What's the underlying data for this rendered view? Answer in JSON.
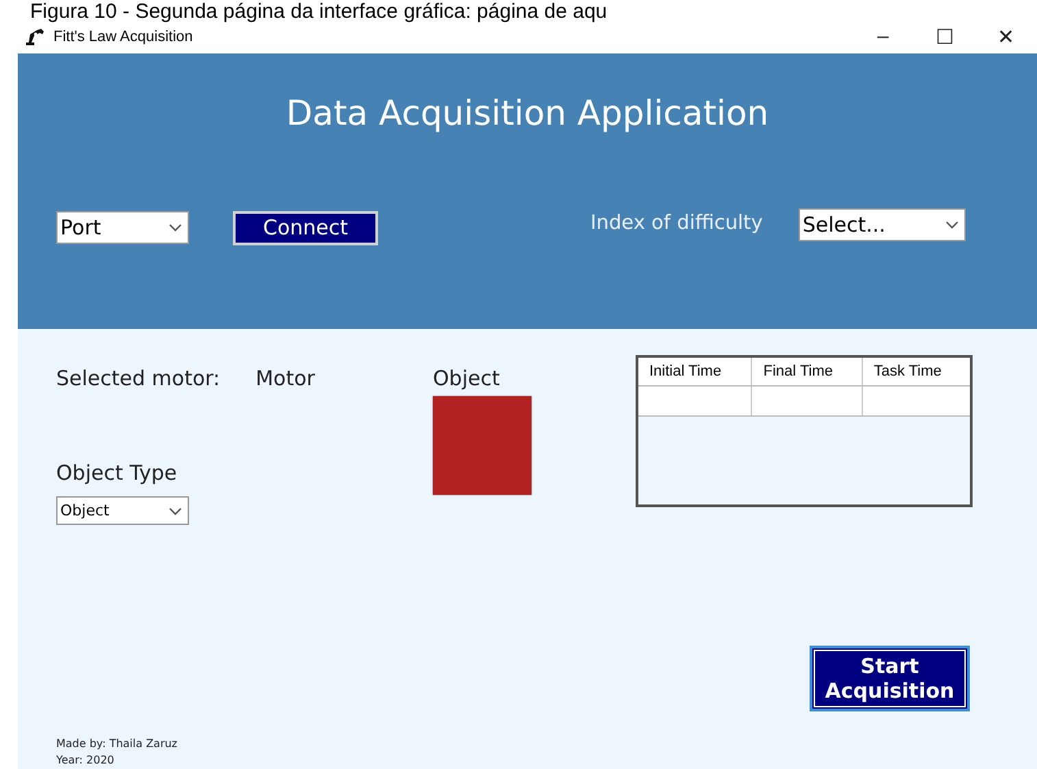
{
  "caption": "Figura 10 - Segunda página da interface gráfica: página de aqu",
  "window": {
    "title": "Fitt's Law Acquisition",
    "controls": [
      "–",
      "☐",
      "✕"
    ]
  },
  "header": {
    "title": "Data Acquisition Application",
    "port": {
      "value": "Port"
    },
    "connect_button": "Connect",
    "difficulty": {
      "label": "Index of difficulty",
      "value": "Select..."
    }
  },
  "body": {
    "selected_motor": {
      "label": "Selected motor:",
      "value": "Motor"
    },
    "object": {
      "label": "Object",
      "color": "#b22222"
    },
    "object_type": {
      "label": "Object Type",
      "value": "Object"
    },
    "table": {
      "columns": [
        "Initial Time",
        "Final Time",
        "Task Time"
      ],
      "rows": [
        [
          "",
          "",
          ""
        ]
      ]
    },
    "start_button": "Start Acquisition",
    "footer": [
      "Made by: Thaila Zaruz",
      "Year: 2020"
    ]
  }
}
